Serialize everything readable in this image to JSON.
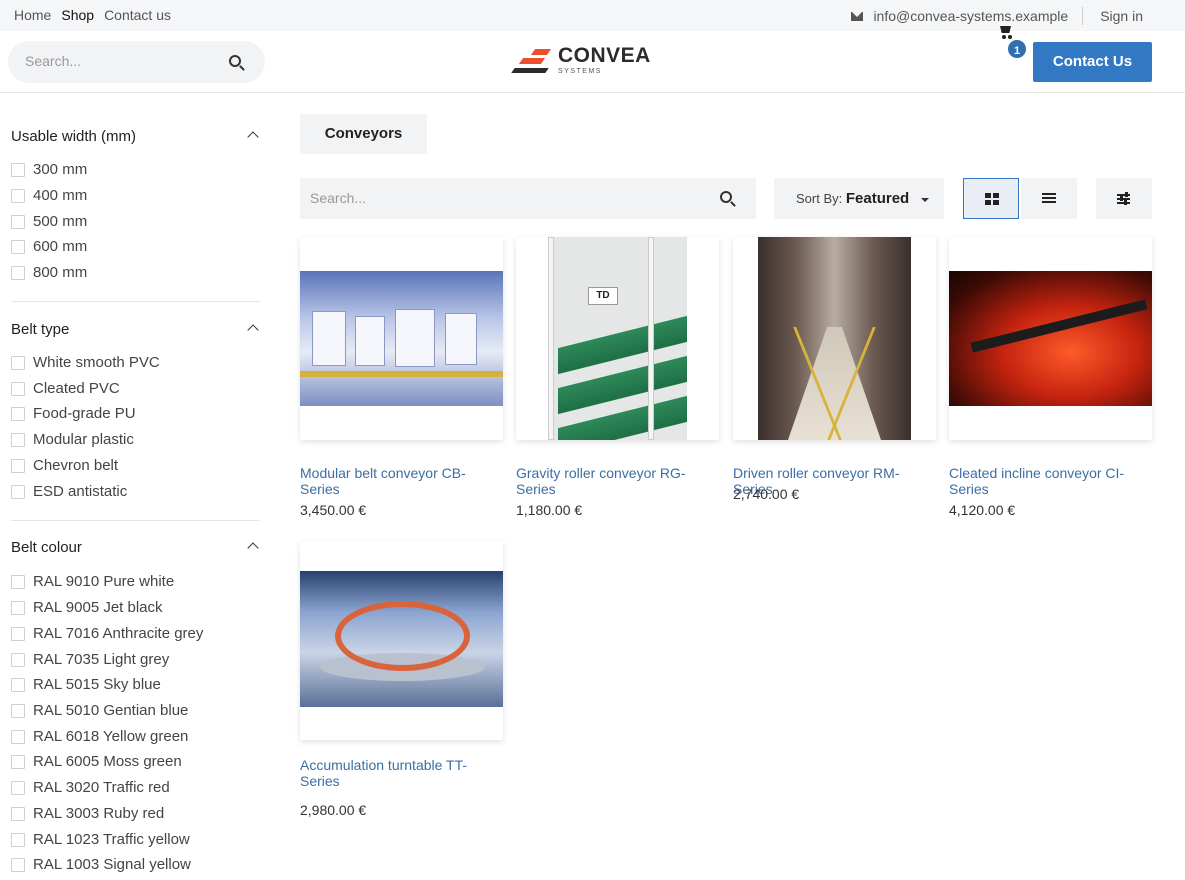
{
  "topbar": {
    "nav": [
      "Home",
      "Shop",
      "Contact us"
    ],
    "active": "Shop",
    "email": "info@convea-systems.example",
    "signin": "Sign in"
  },
  "header": {
    "search_placeholder": "Search...",
    "logo_name": "CONVEA",
    "logo_sub": "SYSTEMS",
    "cart_count": "1",
    "contact_label": "Contact Us",
    "accent_color": "#3378c2",
    "logo_color": "#e9502b"
  },
  "filters": {
    "width": {
      "title": "Usable width (mm)",
      "options": [
        "300 mm",
        "400 mm",
        "500 mm",
        "600 mm",
        "800 mm"
      ]
    },
    "belt_type": {
      "title": "Belt type",
      "options": [
        "White smooth PVC",
        "Cleated PVC",
        "Food-grade PU",
        "Modular plastic",
        "Chevron belt",
        "ESD antistatic"
      ]
    },
    "belt_colour": {
      "title": "Belt colour",
      "options": [
        "RAL 9010 Pure white",
        "RAL 9005 Jet black",
        "RAL 7016 Anthracite grey",
        "RAL 7035 Light grey",
        "RAL 5015 Sky blue",
        "RAL 5010 Gentian blue",
        "RAL 6018 Yellow green",
        "RAL 6005 Moss green",
        "RAL 3020 Traffic red",
        "RAL 3003 Ruby red",
        "RAL 1023 Traffic yellow",
        "RAL 1003 Signal yellow"
      ]
    }
  },
  "main": {
    "category": "Conveyors",
    "search_placeholder": "Search...",
    "sort_label": "Sort By:",
    "sort_value": "Featured",
    "view_active": "grid"
  },
  "products": [
    {
      "title": "Modular belt conveyor CB-Series",
      "price": "3,450.00 €",
      "image": "factory-line"
    },
    {
      "title": "Gravity roller conveyor RG-Series",
      "price": "1,180.00 €",
      "image": "green-roller-rack"
    },
    {
      "title": "Driven roller conveyor RM-Series",
      "price": "2,740.00 €",
      "image": "warehouse-aisle"
    },
    {
      "title": "Cleated incline conveyor CI-Series",
      "price": "4,120.00 €",
      "image": "red-lit-incline"
    },
    {
      "title": "Accumulation turntable TT-Series",
      "price": "2,980.00 €",
      "image": "turntable-hall"
    }
  ]
}
